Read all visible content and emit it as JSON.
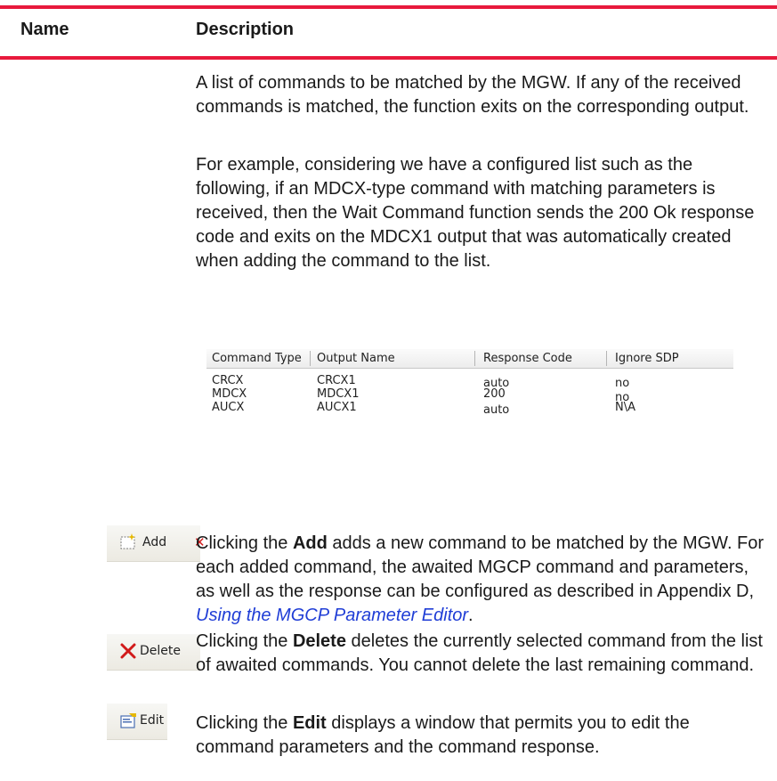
{
  "table_header": {
    "name": "Name",
    "description": "Description"
  },
  "intro": {
    "p1": "A list of commands to be matched by the MGW. If any of the received commands is matched, the function exits on the corresponding output.",
    "p2": "For example, considering we have a configured list such as the following, if an MDCX-type command with matching parameters is received, then the Wait Command function sends the 200 Ok response code and exits on the MDCX1 output that was automatically created when adding the command to the list."
  },
  "command_list": {
    "columns": [
      "Command Type",
      "Output Name",
      "Response Code",
      "Ignore SDP"
    ],
    "rows": [
      [
        "CRCX",
        "CRCX1",
        "auto",
        "no"
      ],
      [
        "MDCX",
        "MDCX1",
        "200",
        "no"
      ],
      [
        "AUCX",
        "AUCX1",
        "auto",
        "N\\A"
      ]
    ]
  },
  "buttons": {
    "add": {
      "label": "Add",
      "desc_prefix": "Clicking the ",
      "desc_bold": "Add",
      "desc_rest": "  adds a new command to be matched by the MGW. For each added command, the awaited MGCP command and parameters, as well as the response can be configured as described in Appendix D, ",
      "desc_link": "Using the MGCP Parameter Editor",
      "desc_end": "."
    },
    "delete": {
      "label": "Delete",
      "desc_prefix": "Clicking the ",
      "desc_bold": "Delete",
      "desc_rest": "  deletes the currently selected command from the list of awaited commands. You cannot delete the last remaining command."
    },
    "edit": {
      "label": "Edit",
      "desc_prefix": "Clicking the ",
      "desc_bold": "Edit",
      "desc_rest": "  displays a window that permits you to edit the command parameters and the command response."
    }
  },
  "colors": {
    "rule": "#e8193c",
    "link": "#1f3dd6",
    "delete_icon": "#d11a1a"
  }
}
